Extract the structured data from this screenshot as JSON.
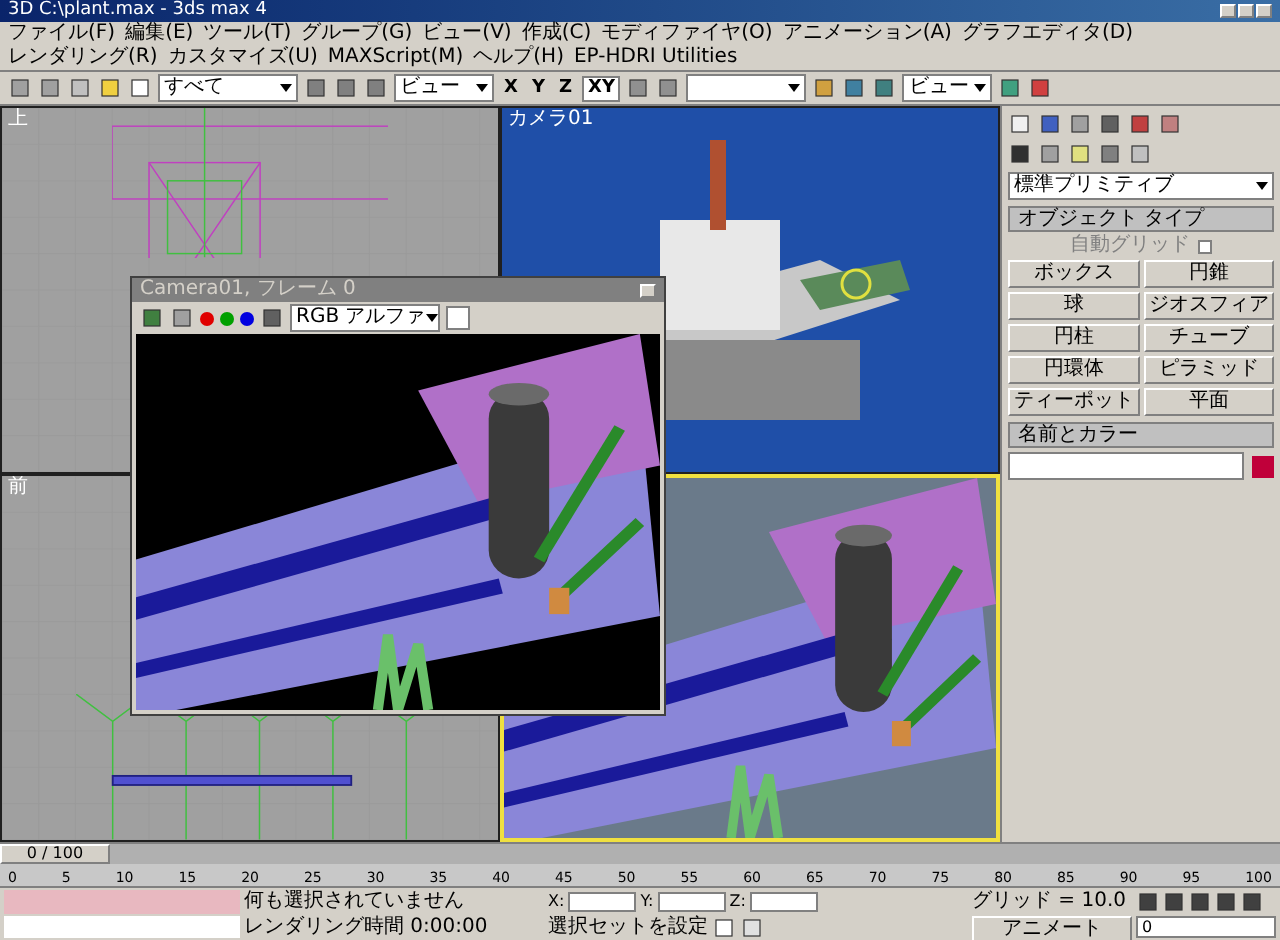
{
  "window": {
    "title": "3D C:\\plant.max - 3ds max 4"
  },
  "menu": [
    "ファイル(F)",
    "編集(E)",
    "ツール(T)",
    "グループ(G)",
    "ビュー(V)",
    "作成(C)",
    "モディファイヤ(O)",
    "アニメーション(A)",
    "グラフエディタ(D)",
    "レンダリング(R)",
    "カスタマイズ(U)",
    "MAXScript(M)",
    "ヘルプ(H)",
    "EP-HDRI Utilities"
  ],
  "toolbar": {
    "selection_filter": "すべて",
    "coordinate_system": "ビュー",
    "render_type": "ビュー",
    "axes": [
      {
        "label": "X",
        "selected": false
      },
      {
        "label": "Y",
        "selected": false
      },
      {
        "label": "Z",
        "selected": false
      },
      {
        "label": "XY",
        "selected": true
      }
    ]
  },
  "viewports": [
    {
      "label": "上",
      "kind": "wire_top",
      "active": false
    },
    {
      "label": "カメラ01",
      "kind": "photo",
      "active": false
    },
    {
      "label": "前",
      "kind": "wire_front",
      "active": false
    },
    {
      "kind": "shaded",
      "active": true
    }
  ],
  "render_window": {
    "title": "Camera01, フレーム 0",
    "channel": "RGB アルファ",
    "channels": [
      {
        "color": "#e00000"
      },
      {
        "color": "#00a000"
      },
      {
        "color": "#0000e0"
      }
    ]
  },
  "command_panel": {
    "category": "標準プリミティブ",
    "rollouts": [
      {
        "title": "オブジェクト タイプ",
        "kind": "buttons",
        "option": "自動グリッド",
        "option_checked": false,
        "items": [
          "ボックス",
          "円錐",
          "球",
          "ジオスフィア",
          "円柱",
          "チューブ",
          "円環体",
          "ピラミッド",
          "ティーポット",
          "平面"
        ]
      },
      {
        "title": "名前とカラー",
        "kind": "name",
        "color": "#c0003a"
      }
    ]
  },
  "timeline": {
    "frame": "0 / 100",
    "level": 0,
    "ticks": [
      "0",
      "5",
      "10",
      "15",
      "20",
      "25",
      "30",
      "35",
      "40",
      "45",
      "50",
      "55",
      "60",
      "65",
      "70",
      "75",
      "80",
      "85",
      "90",
      "95",
      "100"
    ]
  },
  "status": {
    "prompt": "何も選択されていません",
    "render_time": "レンダリング時間  0:00:00",
    "x_label": "X:",
    "y_label": "Y:",
    "z_label": "Z:",
    "grid": "グリッド = 10.0",
    "animate": "アニメート",
    "key_mode": "選択セットを設定",
    "current_frame": "0"
  }
}
